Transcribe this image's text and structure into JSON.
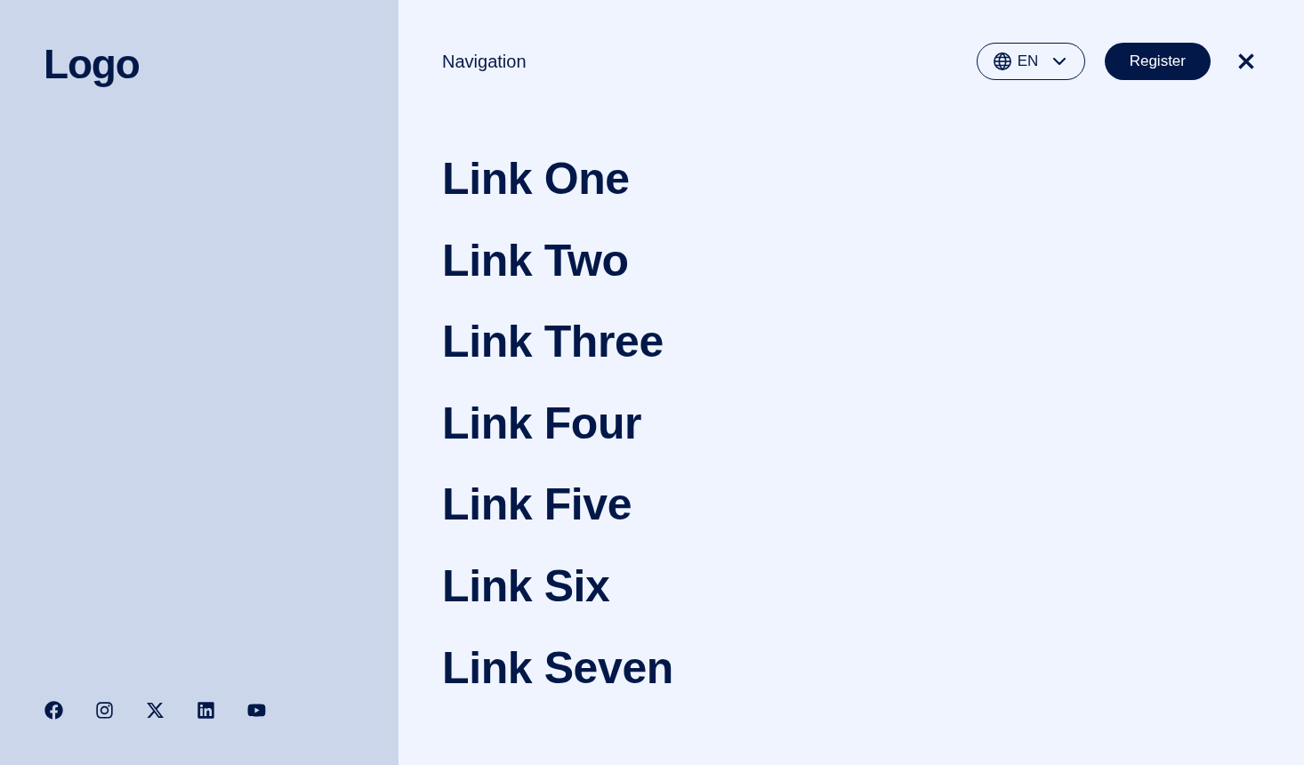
{
  "sidebar": {
    "logo": "Logo",
    "social_links": [
      {
        "kind": "facebook"
      },
      {
        "kind": "instagram"
      },
      {
        "kind": "x"
      },
      {
        "kind": "linkedin"
      },
      {
        "kind": "youtube"
      }
    ]
  },
  "header": {
    "title": "Navigation",
    "language": {
      "code": "EN"
    },
    "register_button": "Register"
  },
  "nav_links": [
    "Link One",
    "Link Two",
    "Link Three",
    "Link Four",
    "Link Five",
    "Link Six",
    "Link Seven"
  ]
}
